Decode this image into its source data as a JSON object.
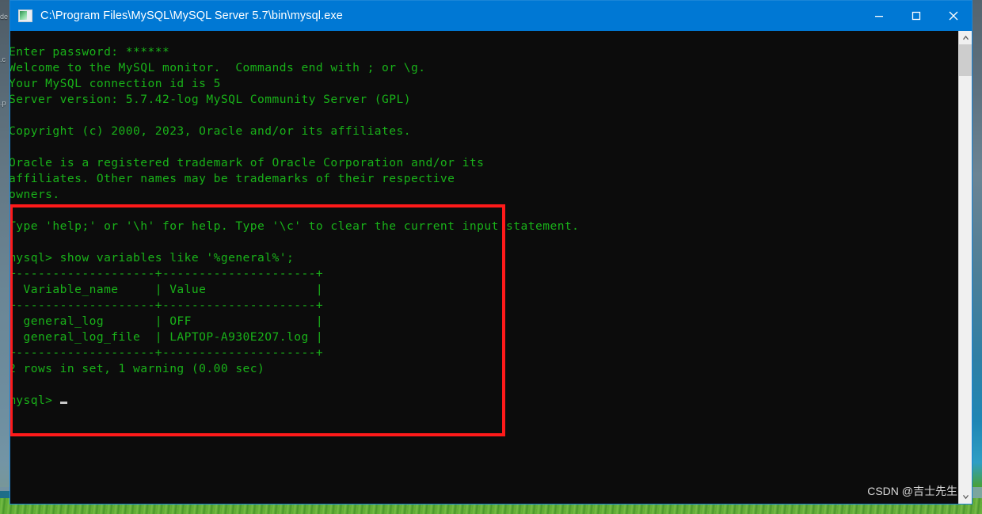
{
  "window": {
    "title": "C:\\Program Files\\MySQL\\MySQL Server 5.7\\bin\\mysql.exe",
    "icon": "console-app-icon",
    "titlebar_color": "#0078d4",
    "border_color": "#1a86d8",
    "controls": {
      "minimize": "minimize-button",
      "maximize": "maximize-button",
      "close": "close-button"
    }
  },
  "console": {
    "background_color": "#0c0c0c",
    "text_color": "#19b219",
    "lines": [
      "Enter password: ******",
      "Welcome to the MySQL monitor.  Commands end with ; or \\g.",
      "Your MySQL connection id is 5",
      "Server version: 5.7.42-log MySQL Community Server (GPL)",
      "",
      "Copyright (c) 2000, 2023, Oracle and/or its affiliates.",
      "",
      "Oracle is a registered trademark of Oracle Corporation and/or its",
      "affiliates. Other names may be trademarks of their respective",
      "owners.",
      "",
      "Type 'help;' or '\\h' for help. Type '\\c' to clear the current input statement.",
      "",
      "mysql> show variables like '%general%';",
      "+-------------------+---------------------+",
      "| Variable_name     | Value               |",
      "+-------------------+---------------------+",
      "| general_log       | OFF                 |",
      "| general_log_file  | LAPTOP-A930E2O7.log |",
      "+-------------------+---------------------+",
      "2 rows in set, 1 warning (0.00 sec)",
      ""
    ],
    "prompt": "mysql> ",
    "cursor": "block-cursor"
  },
  "query_result": {
    "command": "show variables like '%general%';",
    "columns": [
      "Variable_name",
      "Value"
    ],
    "rows": [
      [
        "general_log",
        "OFF"
      ],
      [
        "general_log_file",
        "LAPTOP-A930E2O7.log"
      ]
    ],
    "status": "2 rows in set, 1 warning (0.00 sec)"
  },
  "annotation": {
    "type": "red-rectangle-highlight",
    "color": "#ff1a1a"
  },
  "scrollbar": {
    "up_arrow": "scroll-up-arrow",
    "down_arrow": "scroll-down-arrow",
    "thumb": "scroll-thumb"
  },
  "watermark": {
    "text": "CSDN @吉士先生"
  },
  "desktop": {
    "icon_labels": [
      "de",
      ".c",
      ".p"
    ]
  }
}
